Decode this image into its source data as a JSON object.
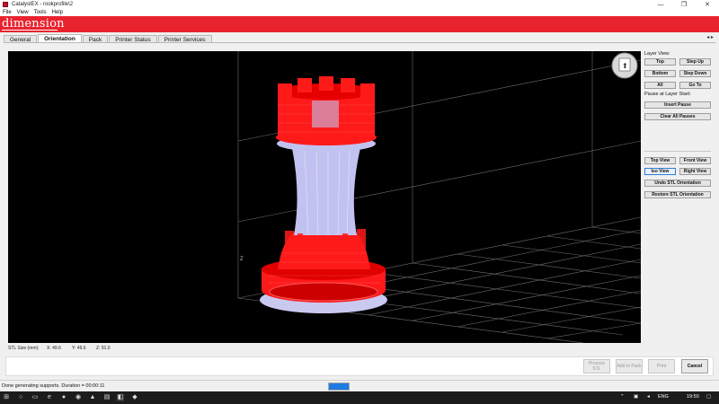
{
  "window": {
    "title": "CatalystEX - rookprofile\\2",
    "controls": [
      "—",
      "❐",
      "✕"
    ]
  },
  "menu": [
    "File",
    "View",
    "Tools",
    "Help"
  ],
  "brand": "dimension",
  "tabs": [
    {
      "label": "General",
      "active": false
    },
    {
      "label": "Orientation",
      "active": true
    },
    {
      "label": "Pack",
      "active": false
    },
    {
      "label": "Printer Status",
      "active": false
    },
    {
      "label": "Printer Services",
      "active": false
    }
  ],
  "tab_arrows": "◂ ▸",
  "viewport": {
    "axis_label": "Z",
    "navcube_label": "⬆"
  },
  "panel": {
    "layer_view_label": "Layer View:",
    "top": "Top",
    "step_up": "Step Up",
    "bottom": "Bottom",
    "step_down": "Step Down",
    "all": "All",
    "go_to": "Go To",
    "pause_label": "Pause at Layer Start:",
    "insert_pause": "Insert Pause",
    "clear_all_pauses": "Clear All Pauses",
    "top_view": "Top View",
    "front_view": "Front View",
    "iso_view": "Iso View",
    "right_view": "Right View",
    "undo_stl": "Undo STL Orientation",
    "restore_stl": "Restore STL Orientation"
  },
  "stl_size": {
    "label": "STL Size (mm):",
    "x": "X: 49.6",
    "y": "Y: 49.6",
    "z": "Z: 91.0"
  },
  "actions": {
    "process_stl": "Process STL",
    "add_to_pack": "Add to Pack",
    "print": "Print",
    "cancel": "Cancel"
  },
  "status": {
    "text": "Done generating supports. Duration = 00:00:11",
    "progress": 1.0
  },
  "taskbar": {
    "icons": [
      "windows-start-icon",
      "search-icon",
      "task-view-icon",
      "file-explorer-icon",
      "edge-icon",
      "firefox-icon",
      "chrome-icon",
      "app-icon",
      "catalystex-icon",
      "app-icon-2"
    ],
    "language": "ENG",
    "time": "19:50"
  },
  "colors": {
    "banner": "#e8232e",
    "model_red": "#ff1a1a",
    "model_support": "#b9b9ee",
    "grid": "#7a7a7a"
  }
}
